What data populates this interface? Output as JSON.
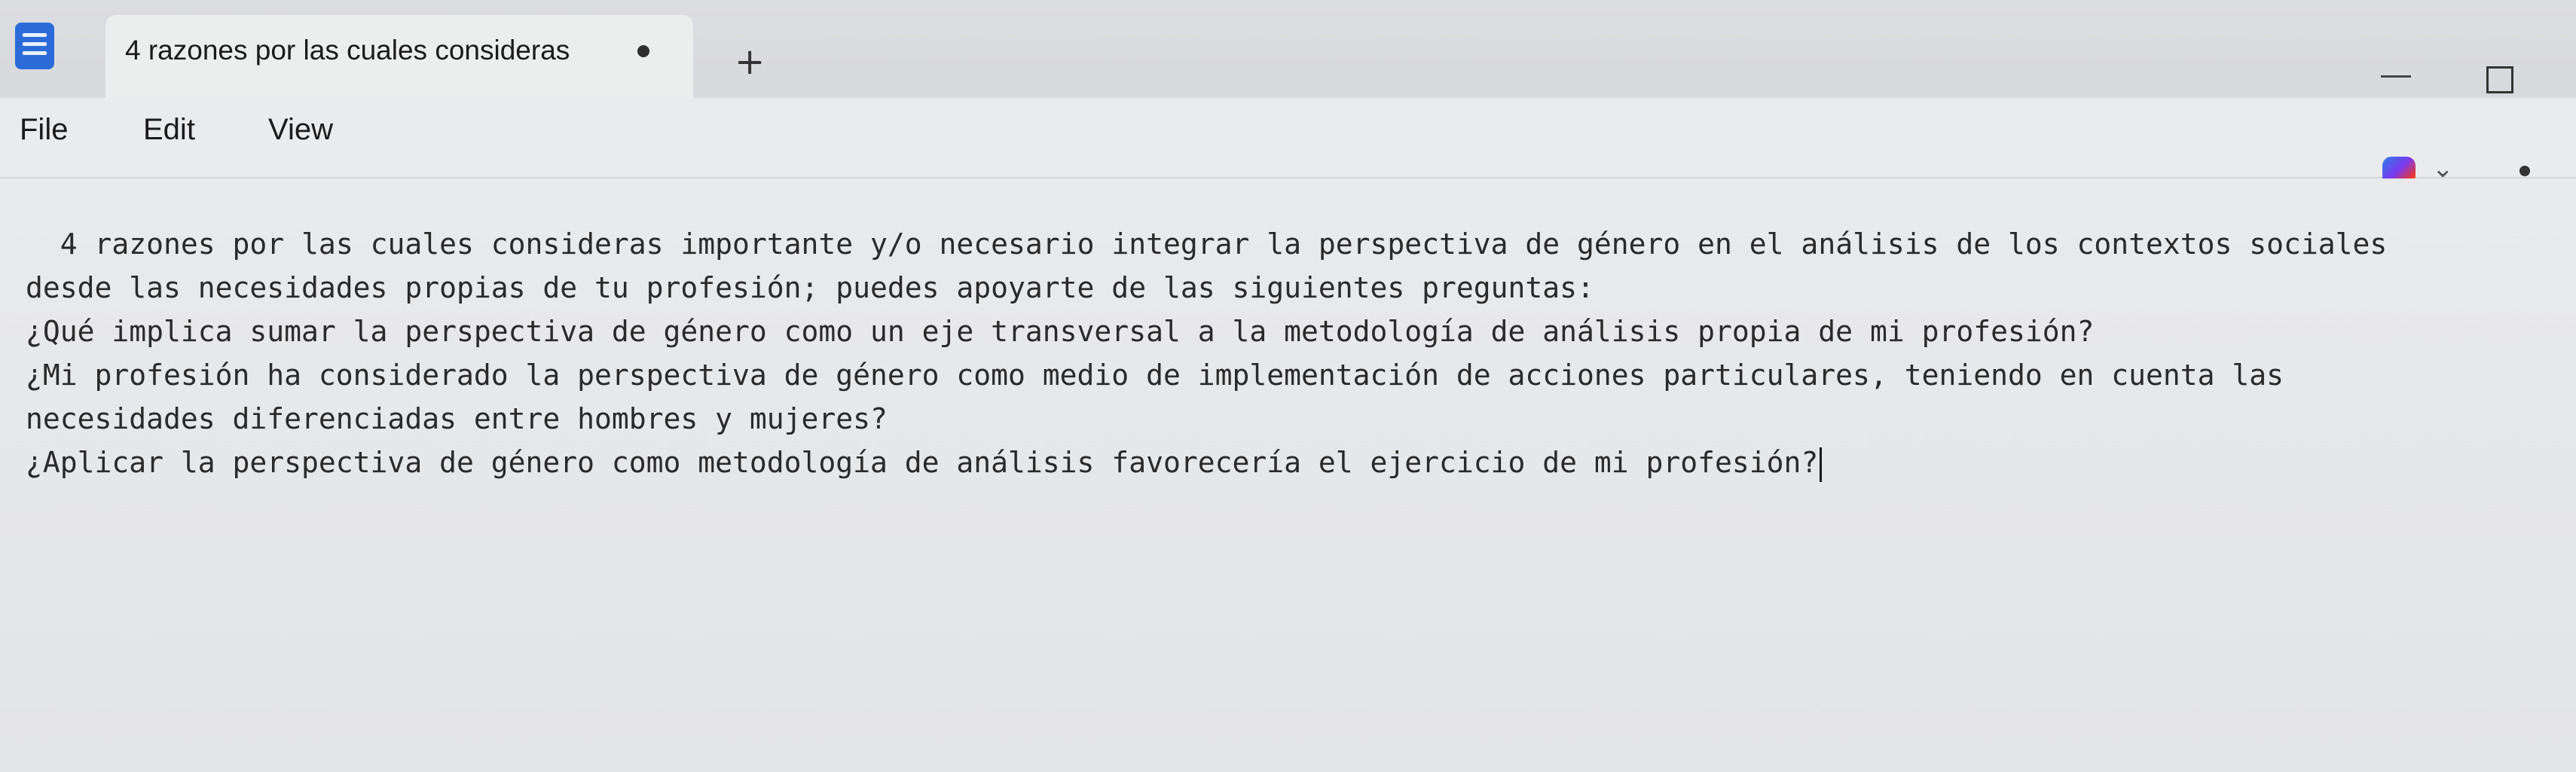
{
  "tab": {
    "title": "4 razones por las cuales consideras",
    "new_tab": "+"
  },
  "menu": {
    "file": "File",
    "edit": "Edit",
    "view": "View"
  },
  "icons": {
    "app": "notepad-icon",
    "unsaved": "unsaved-dot-icon",
    "copilot": "copilot-icon",
    "dropdown": "chevron-down-icon",
    "account": "account-icon",
    "minimize": "minimize-icon",
    "maximize": "maximize-icon"
  },
  "document": {
    "lines": [
      "  4 razones por las cuales consideras importante y/o necesario integrar la perspectiva de género en el análisis de los contextos sociales",
      "desde las necesidades propias de tu profesión; puedes apoyarte de las siguientes preguntas:",
      "¿Qué implica sumar la perspectiva de género como un eje transversal a la metodología de análisis propia de mi profesión?",
      "¿Mi profesión ha considerado la perspectiva de género como medio de implementación de acciones particulares, teniendo en cuenta las",
      "necesidades diferenciadas entre hombres y mujeres?",
      "¿Aplicar la perspectiva de género como metodología de análisis favorecería el ejercicio de mi profesión?"
    ]
  }
}
